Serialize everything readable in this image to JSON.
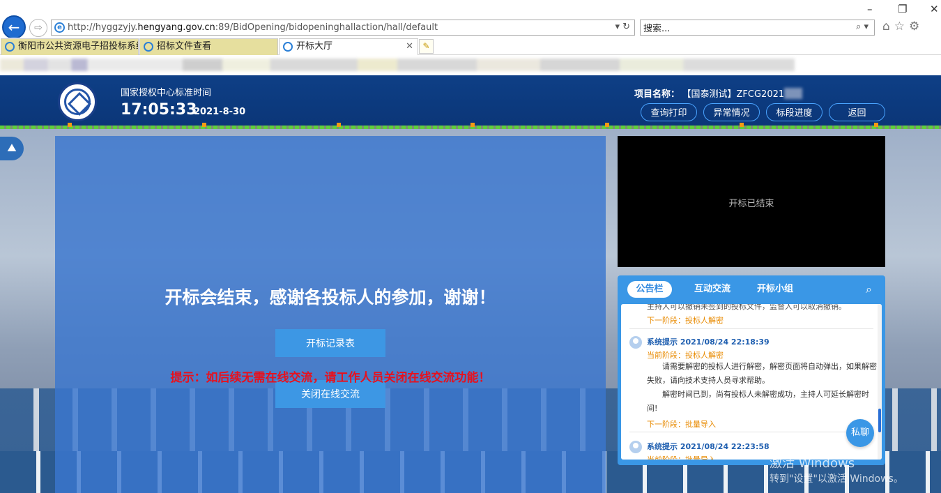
{
  "browser": {
    "url_prefix": "http://hyggzyjy.",
    "url_domain": "hengyang.gov.cn",
    "url_suffix": ":89/BidOpening/bidopeninghallaction/hall/default",
    "search_placeholder": "搜索...",
    "tabs": [
      {
        "label": "衡阳市公共资源电子招投标系统",
        "active": false
      },
      {
        "label": "招标文件查看",
        "active": false
      },
      {
        "label": "开标大厅",
        "active": true
      }
    ]
  },
  "header": {
    "time_label": "国家授权中心标准时间",
    "clock": "17:05:33",
    "date": "2021-8-30",
    "project_label": "项目名称：",
    "project_value": "【国泰测试】ZFCG2021",
    "buttons": [
      "查询打印",
      "异常情况",
      "标段进度",
      "返回"
    ]
  },
  "main": {
    "end_message": "开标会结束，感谢各投标人的参加，谢谢！",
    "record_button": "开标记录表",
    "hint": "提示：如后续无需在线交流，请工作人员关闭在线交流功能！",
    "close_chat_button": "关闭在线交流"
  },
  "video": {
    "status": "开标已结束"
  },
  "board": {
    "tabs": [
      "公告栏",
      "互动交流",
      "开标小组"
    ],
    "partial_text": "主持人可以撤销未签到的投标文件，监督人可以取消撤销。",
    "partial_next": "下一阶段：投标人解密",
    "messages": [
      {
        "title": "系统提示 2021/08/24 22:18:39",
        "current": "当前阶段：投标人解密",
        "body": [
          "请需要解密的投标人进行解密，解密页面将自动弹出，如果解密失败，请向技术支持人员寻求帮助。",
          "解密时间已到，尚有投标人未解密成功，主持人可延长解密时间!"
        ],
        "next": "下一阶段：批量导入"
      },
      {
        "title": "系统提示 2021/08/24 22:23:58",
        "current": "当前阶段：批量导入"
      }
    ],
    "private_chat": "私聊"
  },
  "watermark": {
    "line1": "激活 Windows",
    "line2": "转到\"设置\"以激活 Windows。"
  },
  "colors": {
    "header_bg": "#0e3f86",
    "panel_bg": "#3a76ce",
    "button_blue": "#3d97e4",
    "hint_red": "#e8101c",
    "stage_orange": "#e88a00"
  }
}
